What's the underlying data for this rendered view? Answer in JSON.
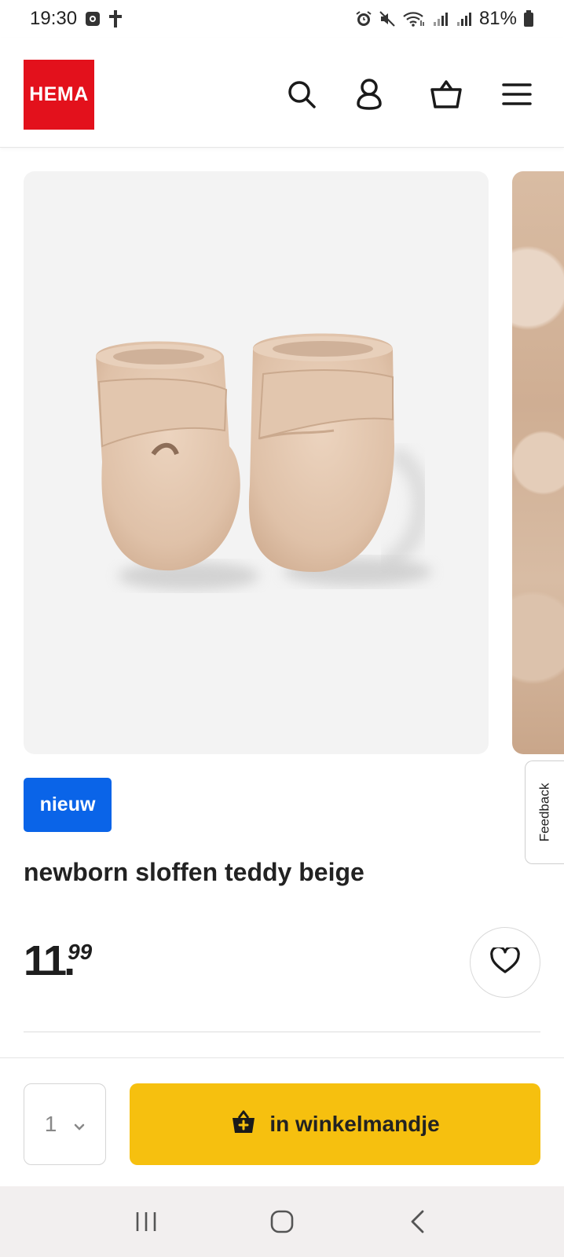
{
  "status_bar": {
    "time": "19:30",
    "battery": "81%",
    "left_icons": [
      "screen-record-icon",
      "cross-icon"
    ],
    "right_icons": [
      "alarm-icon",
      "mute-icon",
      "wifi-icon",
      "signal-icon",
      "signal-icon-2",
      "battery-icon"
    ]
  },
  "header": {
    "logo_text": "HEMA",
    "icons": [
      "search-icon",
      "account-icon",
      "basket-icon",
      "menu-icon"
    ]
  },
  "product": {
    "badge": "nieuw",
    "title": "newborn sloffen teddy beige",
    "price_main": "11",
    "price_cents": "99"
  },
  "feedback_label": "Feedback",
  "buy_bar": {
    "quantity": "1",
    "add_to_cart_label": "in winkelmandje"
  },
  "colors": {
    "brand_red": "#e3111c",
    "badge_blue": "#0a64e8",
    "cta_yellow": "#f6c00f"
  }
}
